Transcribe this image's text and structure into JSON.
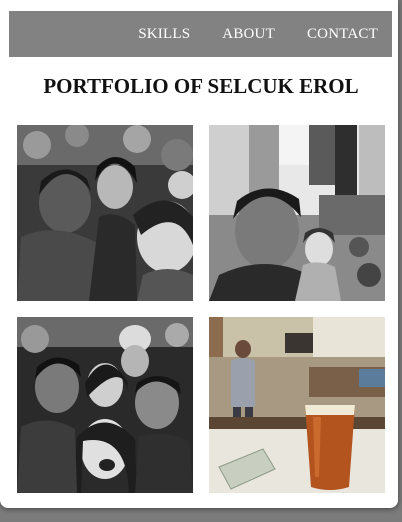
{
  "nav": {
    "items": [
      {
        "label": "SKILLS"
      },
      {
        "label": "ABOUT"
      },
      {
        "label": "CONTACT"
      }
    ]
  },
  "page": {
    "title": "PORTFOLIO OF SELCUK EROL"
  },
  "gallery": {
    "photos": [
      {
        "subject": "group-selfie-crowd",
        "tone": "grayscale"
      },
      {
        "subject": "selfie-times-square",
        "tone": "grayscale"
      },
      {
        "subject": "group-selfie-four-people",
        "tone": "grayscale"
      },
      {
        "subject": "beer-glass-on-bar",
        "tone": "color"
      }
    ]
  }
}
